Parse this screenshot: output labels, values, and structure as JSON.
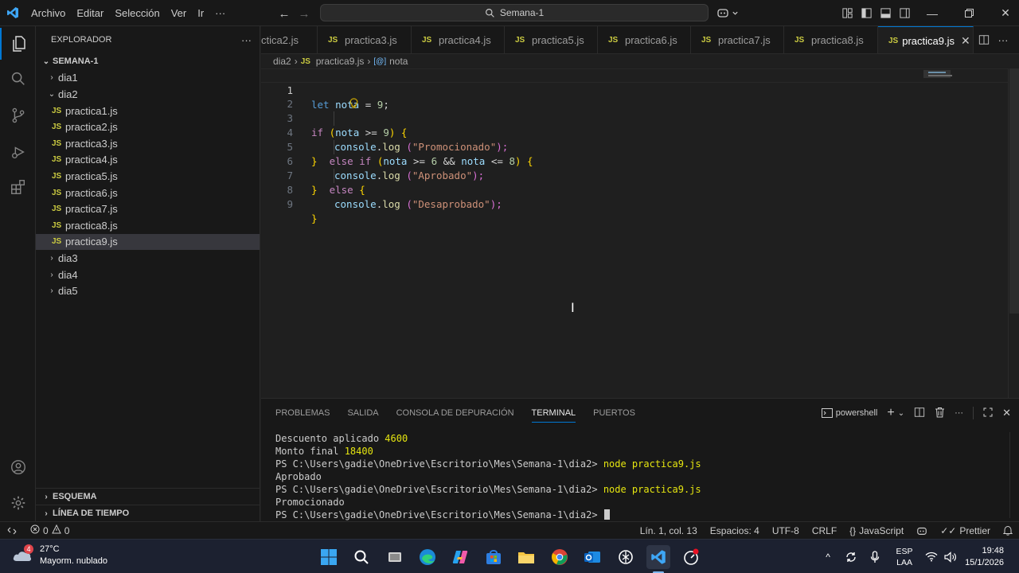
{
  "titlebar": {
    "menu": [
      "Archivo",
      "Editar",
      "Selección",
      "Ver",
      "Ir"
    ],
    "more": "···",
    "search_text": "Semana-1"
  },
  "explorer": {
    "title": "EXPLORADOR",
    "more": "···",
    "root": "SEMANA-1",
    "folders": {
      "dia1": "dia1",
      "dia2": "dia2",
      "dia3": "dia3",
      "dia4": "dia4",
      "dia5": "dia5"
    },
    "files": [
      "practica1.js",
      "practica2.js",
      "practica3.js",
      "practica4.js",
      "practica5.js",
      "practica6.js",
      "practica7.js",
      "practica8.js",
      "practica9.js"
    ],
    "js_badge": "JS",
    "outline": "ESQUEMA",
    "timeline": "LÍNEA DE TIEMPO"
  },
  "tabs": {
    "first_partial": "ctica2.js",
    "items": [
      "practica3.js",
      "practica4.js",
      "practica5.js",
      "practica6.js",
      "practica7.js",
      "practica8.js"
    ],
    "active": "practica9.js"
  },
  "breadcrumb": {
    "folder": "dia2",
    "file": "practica9.js",
    "symbol": "nota"
  },
  "editor": {
    "line_numbers": [
      "1",
      "2",
      "3",
      "4",
      "5",
      "6",
      "7",
      "8",
      "9"
    ],
    "l1": {
      "kw": "let",
      "var": "nota",
      "eq": " = ",
      "num": "9",
      "end": ";"
    },
    "l3": {
      "kw": "if",
      "open": " (",
      "var": "nota",
      "op": " >= ",
      "num": "9",
      "close": ") {"
    },
    "l4": {
      "obj": "console",
      "dot": ".",
      "fn": "log",
      "open": " (",
      "str": "\"Promocionado\"",
      "close": ");"
    },
    "l5": {
      "brace": "}",
      "kw1": "else",
      "kw2": "if",
      "open": " (",
      "var1": "nota",
      "op1": " >= ",
      "num1": "6",
      "and": " && ",
      "var2": "nota",
      "op2": " <= ",
      "num2": "8",
      "close": ") {"
    },
    "l6": {
      "obj": "console",
      "dot": ".",
      "fn": "log",
      "open": " (",
      "str": "\"Aprobado\"",
      "close": ");"
    },
    "l7": {
      "brace": "}",
      "kw": "else",
      "open": " {"
    },
    "l8": {
      "obj": "console",
      "dot": ".",
      "fn": "log",
      "open": " (",
      "str": "\"Desaprobado\"",
      "close": ");"
    },
    "l9": {
      "brace": "}"
    }
  },
  "panel": {
    "tabs": [
      "PROBLEMAS",
      "SALIDA",
      "CONSOLA DE DEPURACIÓN",
      "TERMINAL",
      "PUERTOS"
    ],
    "active_tab": "TERMINAL",
    "shell": "powershell",
    "terminal": {
      "l1_label": "Descuento aplicado ",
      "l1_value": "4600",
      "l2_label": "Monto final ",
      "l2_value": "18400",
      "prompt": "PS C:\\Users\\gadie\\OneDrive\\Escritorio\\Mes\\Semana-1\\dia2> ",
      "cmd": "node practica9.js",
      "out1": "Aprobado",
      "out2": "Promocionado"
    }
  },
  "statusbar": {
    "errors": "0",
    "warnings": "0",
    "position": "Lín. 1, col. 13",
    "spaces": "Espacios: 4",
    "encoding": "UTF-8",
    "eol": "CRLF",
    "language": "JavaScript",
    "prettier": "Prettier"
  },
  "taskbar": {
    "weather_badge": "4",
    "temperature": "27°C",
    "condition": "Mayorm. nublado",
    "lang1": "ESP",
    "lang2": "LAA",
    "time": "19:48",
    "date": "15/1/2026"
  },
  "colors": {
    "accent": "#0078d4",
    "js_yellow": "#cbcb41",
    "keyword": "#569cd6",
    "control": "#c586c0",
    "variable": "#9cdcfe",
    "number": "#b5cea8",
    "string": "#ce9178",
    "function": "#dcdcaa"
  }
}
